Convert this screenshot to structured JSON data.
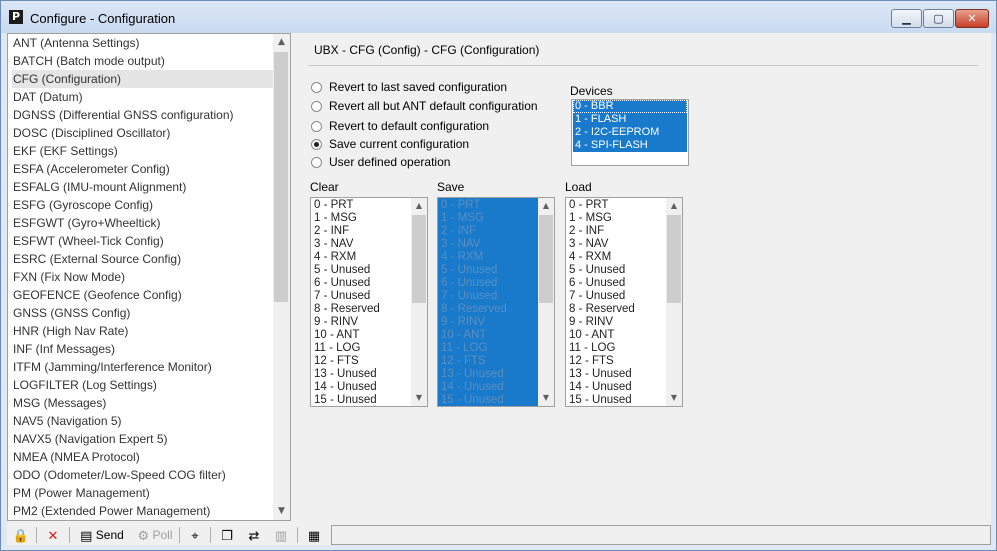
{
  "window": {
    "title": "Configure - Configuration",
    "app_icon_letter": "P"
  },
  "window_buttons": {
    "minimize": "▁",
    "maximize": "▢",
    "close": "✕"
  },
  "message_list": {
    "selected_index": 3,
    "items": [
      "ANT (Antenna Settings)",
      "BATCH (Batch mode output)",
      "CFG (Configuration)",
      "DAT (Datum)",
      "DGNSS (Differential GNSS configuration)",
      "DOSC (Disciplined Oscillator)",
      "EKF (EKF Settings)",
      "ESFA (Accelerometer Config)",
      "ESFALG (IMU-mount Alignment)",
      "ESFG (Gyroscope Config)",
      "ESFGWT (Gyro+Wheeltick)",
      "ESFWT (Wheel-Tick Config)",
      "ESRC (External Source Config)",
      "FXN (Fix Now Mode)",
      "GEOFENCE (Geofence Config)",
      "GNSS (GNSS Config)",
      "HNR (High Nav Rate)",
      "INF (Inf Messages)",
      "ITFM (Jamming/Interference Monitor)",
      "LOGFILTER (Log Settings)",
      "MSG (Messages)",
      "NAV5 (Navigation 5)",
      "NAVX5 (Navigation Expert 5)",
      "NMEA (NMEA Protocol)",
      "ODO (Odometer/Low-Speed COG filter)",
      "PM (Power Management)",
      "PM2 (Extended Power Management)"
    ]
  },
  "config": {
    "header": "UBX - CFG (Config) - CFG (Configuration)",
    "options": [
      {
        "label": "Revert to last saved configuration",
        "checked": false
      },
      {
        "label": "Revert all but ANT default configuration",
        "checked": false
      },
      {
        "label": "Revert to default configuration",
        "checked": false
      },
      {
        "label": "Save current configuration",
        "checked": true
      },
      {
        "label": "User defined operation",
        "checked": false
      }
    ],
    "devices_label": "Devices",
    "devices": [
      "0 - BBR",
      "1 - FLASH",
      "2 - I2C-EEPROM",
      "4 - SPI-FLASH"
    ],
    "clear_label": "Clear",
    "save_label": "Save",
    "load_label": "Load",
    "sections": [
      "0 - PRT",
      "1 - MSG",
      "2 - INF",
      "3 - NAV",
      "4 - RXM",
      "5 - Unused",
      "6 - Unused",
      "7 - Unused",
      "8 - Reserved",
      "9 - RINV",
      "10 - ANT",
      "11 - LOG",
      "12 - FTS",
      "13 - Unused",
      "14 - Unused",
      "15 - Unused"
    ]
  },
  "toolbar": {
    "send_label": "Send",
    "poll_label": "Poll"
  }
}
